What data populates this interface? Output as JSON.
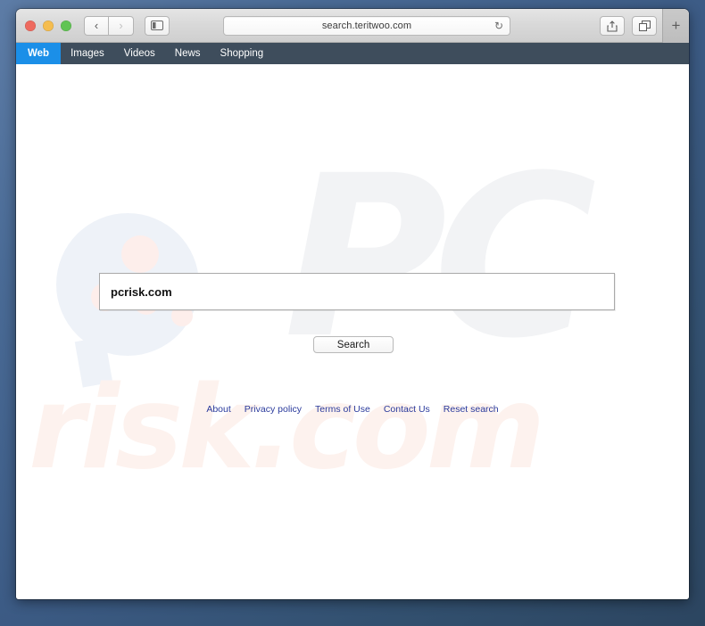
{
  "browser": {
    "window_controls": {
      "close": "close-button",
      "minimize": "minimize-button",
      "maximize": "maximize-button"
    },
    "back_label": "‹",
    "forward_label": "›",
    "sidebar_label": "sidebar-toggle",
    "url": "search.teritwoo.com",
    "reload_label": "↻",
    "share_label": "share",
    "tabs_label": "show-tabs",
    "new_tab_label": "+"
  },
  "site_nav": {
    "items": [
      {
        "label": "Web",
        "active": true
      },
      {
        "label": "Images",
        "active": false
      },
      {
        "label": "Videos",
        "active": false
      },
      {
        "label": "News",
        "active": false
      },
      {
        "label": "Shopping",
        "active": false
      }
    ]
  },
  "search": {
    "query": "pcrisk.com",
    "placeholder": "",
    "button_label": "Search"
  },
  "footer": {
    "links": [
      "About",
      "Privacy policy",
      "Terms of Use",
      "Contact Us",
      "Reset search"
    ]
  },
  "watermark": {
    "pc_text": "PC",
    "risk_text": "risk.com"
  },
  "colors": {
    "nav_bar": "#3e4d5c",
    "nav_active": "#1b8fe8",
    "link": "#2a3a9c",
    "desktop_bg": "#3c5b85",
    "watermark_gray": "#f2f3f5",
    "watermark_pink": "#fdf2ee",
    "watermark_blue": "#eef2f8"
  }
}
